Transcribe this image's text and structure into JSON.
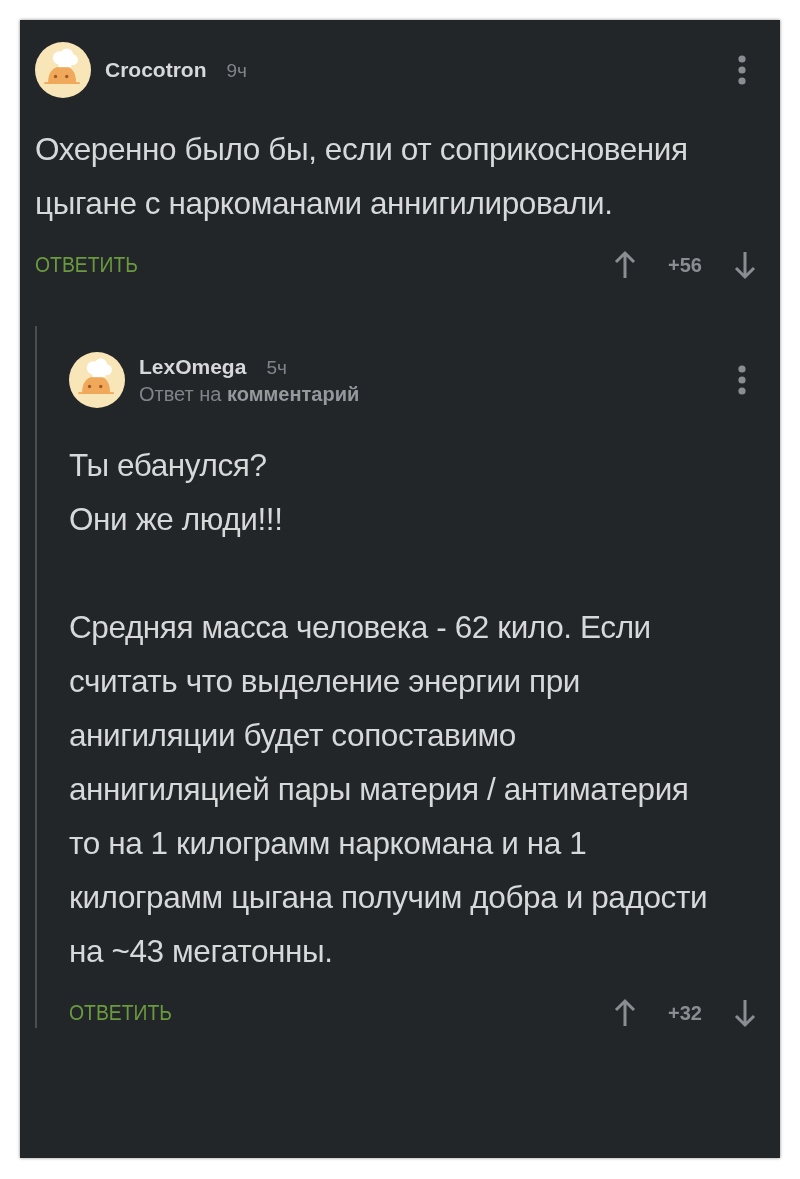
{
  "comments": [
    {
      "author": "Crocotron",
      "time": "9ч",
      "text": "Охеренно было бы, если от соприкосновения цыгане с наркоманами аннигилировали.",
      "reply_button": "ОТВЕТИТЬ",
      "score": "+56",
      "children": [
        {
          "author": "LexOmega",
          "time": "5ч",
          "reply_to": "Ответ на **комментарий**",
          "text": "Ты ебанулся?\nОни же люди!!!\n\nСредняя масса человека - 62 кило. Если считать что выделение энергии при анигиляции будет сопоставимо аннигиляцией пары материя / антиматерия то на 1 килограмм наркомана и на 1 килограмм цыгана получим добра и радости на ~43 мегатонны.",
          "reply_button": "ОТВЕТИТЬ",
          "score": "+32"
        }
      ]
    }
  ]
}
